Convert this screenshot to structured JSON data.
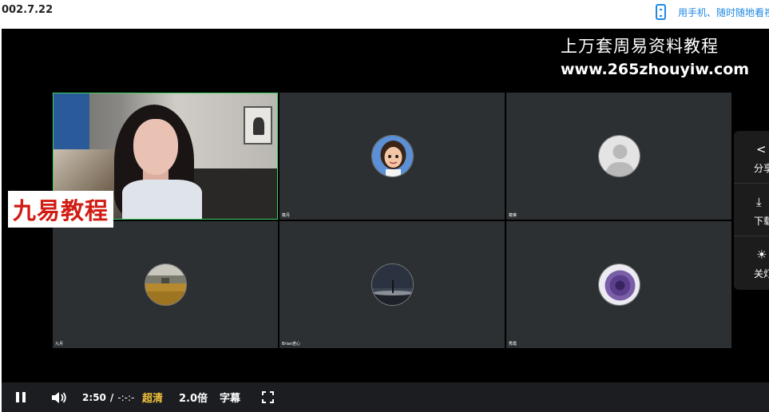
{
  "header": {
    "title": "002.7.22",
    "mobile_link": "用手机、随时随地看视频"
  },
  "watermark": {
    "title": "上万套周易资料教程",
    "url": "www.265zhouyiw.com"
  },
  "logo_text": "九易教程",
  "tiles": [
    {
      "name": "",
      "type": "camera"
    },
    {
      "name": "筱丹",
      "type": "avatar",
      "avatar": "cartoon-girl-avatar"
    },
    {
      "name": "筱琳",
      "type": "avatar",
      "avatar": "default-user-avatar"
    },
    {
      "name": "九月",
      "type": "avatar",
      "avatar": "field-avatar"
    },
    {
      "name": "Brian若心",
      "type": "avatar",
      "avatar": "night-sky-avatar"
    },
    {
      "name": "秀霞",
      "type": "avatar",
      "avatar": "purple-flower-avatar"
    }
  ],
  "side_panel": {
    "share_label": "分享",
    "download_label": "下载",
    "lights_label": "关灯"
  },
  "controls": {
    "current_time": "2:50",
    "separator": "/",
    "duration": "-:-:-",
    "quality": "超清",
    "speed": "2.0倍",
    "subtitles": "字幕"
  },
  "colors": {
    "accent_link": "#1e88e5",
    "quality_active": "#f4c33c",
    "active_speaker_border": "#3fd35e",
    "logo_red": "#d11c13"
  }
}
